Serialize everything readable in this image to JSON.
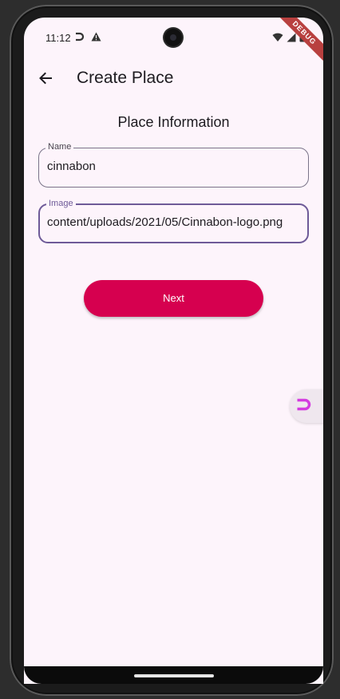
{
  "status_bar": {
    "time": "11:12",
    "debug_banner": "DEBUG"
  },
  "app_bar": {
    "title": "Create Place"
  },
  "form": {
    "section_title": "Place Information",
    "name": {
      "label": "Name",
      "value": "cinnabon"
    },
    "image": {
      "label": "Image",
      "value": "content/uploads/2021/05/Cinnabon-logo.png"
    }
  },
  "actions": {
    "next_label": "Next"
  },
  "colors": {
    "background": "#fdf4fb",
    "primary_button": "#d6004f",
    "focus_outline": "#6e5a98",
    "handle_accent": "#d43ce0"
  },
  "icons": {
    "back": "arrow-left-icon",
    "notification_1": "magnet-icon",
    "notification_2": "warning-icon",
    "wifi": "wifi-icon",
    "signal": "signal-icon",
    "battery": "battery-icon",
    "floating": "magnet-icon"
  }
}
